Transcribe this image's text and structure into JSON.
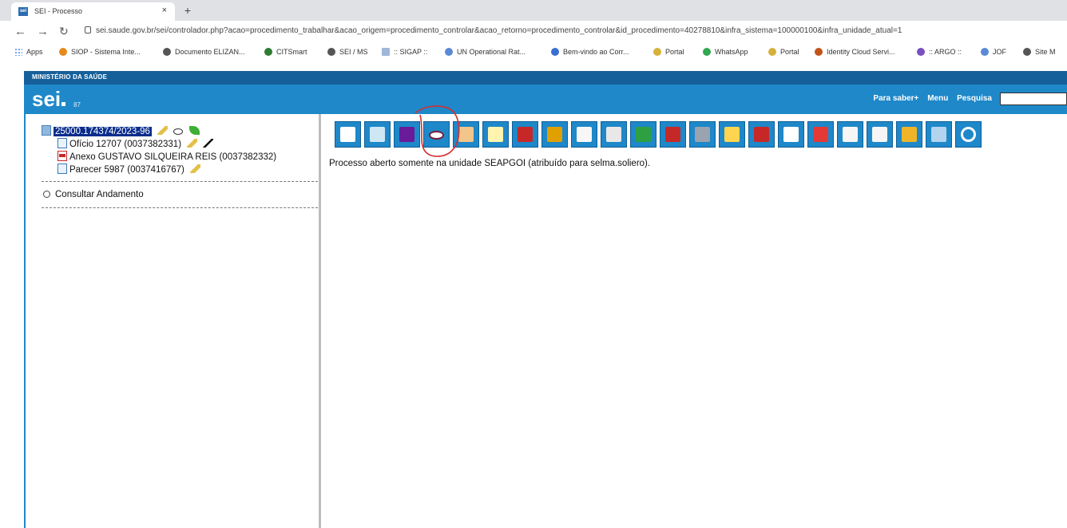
{
  "browser": {
    "tab_title": "SEI - Processo",
    "tab_close": "×",
    "new_tab": "+",
    "url": "sei.saude.gov.br/sei/controlador.php?acao=procedimento_trabalhar&acao_origem=procedimento_controlar&acao_retorno=procedimento_controlar&id_procedimento=40278810&infra_sistema=100000100&infra_unidade_atual=1",
    "bookmarks": [
      "Apps",
      "SIOP - Sistema Inte...",
      "Documento ELIZAN...",
      "CITSmart",
      "SEI / MS",
      ":: SIGAP ::",
      "UN Operational Rat...",
      "Bem-vindo ao Corr...",
      "Portal",
      "WhatsApp",
      "Portal",
      "Identity Cloud Servi...",
      ":: ARGO ::",
      "JOF",
      "Site M"
    ]
  },
  "sei": {
    "ministry": "MINISTÉRIO DA SAÚDE",
    "logo": "sei",
    "version": "87",
    "header_links": [
      "Para saber+",
      "Menu",
      "Pesquisa"
    ],
    "tree": {
      "process": "25000.174374/2023-96",
      "documents": [
        "Ofício 12707 (0037382331)",
        "Anexo GUSTAVO SILQUEIRA REIS (0037382332)",
        "Parecer 5987 (0037416767)"
      ],
      "consult": "Consultar Andamento"
    },
    "message": "Processo aberto somente na unidade SEAPGOI (atribuído para selma.soliero).",
    "toolbar_icons": [
      "new-document-icon",
      "signature-panel-icon",
      "send-process-icon",
      "view-icon",
      "assign-icon",
      "mail-icon",
      "close-unit-icon",
      "block-icon",
      "move-icon",
      "email-icon",
      "reopen-icon",
      "duplicate-icon",
      "relate-icon",
      "annotation-icon",
      "remove-icon",
      "edit-icon",
      "cancel-icon",
      "generate-pdf-icon",
      "generate-zip-icon",
      "tag-icon",
      "list-icon",
      "search-icon"
    ]
  }
}
